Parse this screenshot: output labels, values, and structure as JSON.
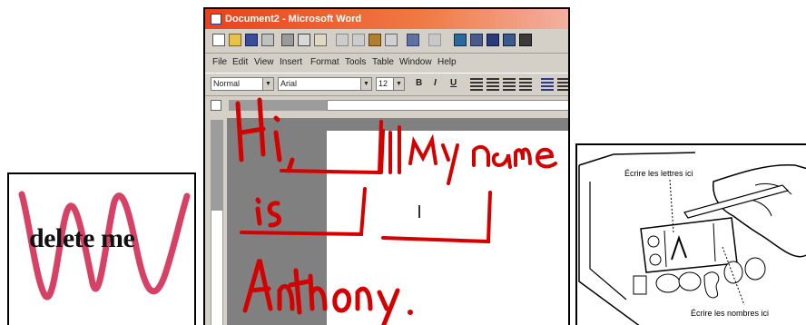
{
  "panels": {
    "delete": {
      "text": "delete me",
      "scribble_color": "#d0204a"
    },
    "word": {
      "window_title": "Document2 - Microsoft Word",
      "menu": [
        "File",
        "Edit",
        "View",
        "Insert",
        "Format",
        "Tools",
        "Table",
        "Window",
        "Help"
      ],
      "style_dropdown": "Normal",
      "font_dropdown": "Arial",
      "size_dropdown": "12",
      "format_buttons": [
        "B",
        "I",
        "U"
      ],
      "handwriting": [
        "Hi,",
        "My name",
        "is",
        "Anthony."
      ],
      "ink_color": "#d40000"
    },
    "pda": {
      "letters_label": "Écrire les lettres ici",
      "numbers_label": "Écrire les nombres ici"
    }
  }
}
